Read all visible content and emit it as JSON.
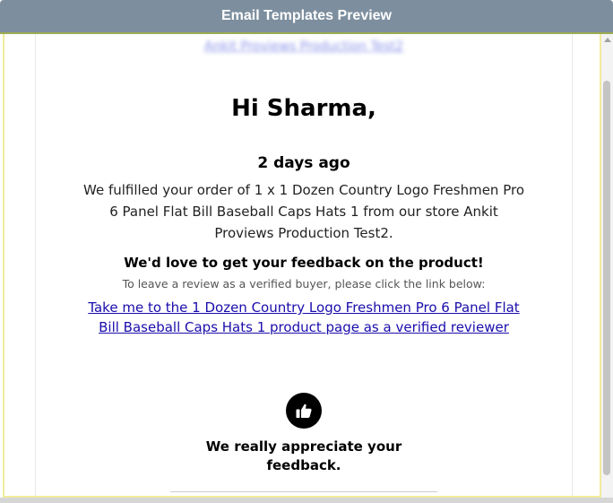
{
  "window": {
    "title": "Email Templates Preview"
  },
  "email": {
    "store_link": "Ankit Proviews Production Test2",
    "greeting": "Hi Sharma,",
    "time_ago": "2 days ago",
    "body": "We fulfilled your order of 1 x 1 Dozen Country Logo Freshmen Pro 6 Panel Flat Bill Baseball Caps Hats 1 from our store Ankit Proviews Production Test2.",
    "feedback_heading": "We'd love to get your feedback on the product!",
    "instruction": "To leave a review as a verified buyer, please click the link below:",
    "product_link": "Take me to the 1 Dozen Country Logo Freshmen Pro 6 Panel Flat Bill Baseball Caps Hats 1 product page as a verified reviewer",
    "appreciation": "We really appreciate your feedback.",
    "thumb_icon": "thumbs-up-icon"
  },
  "colors": {
    "titlebar": "#7d8f9f",
    "link": "#1a0dab",
    "frame_border": "#f0ec9c"
  }
}
